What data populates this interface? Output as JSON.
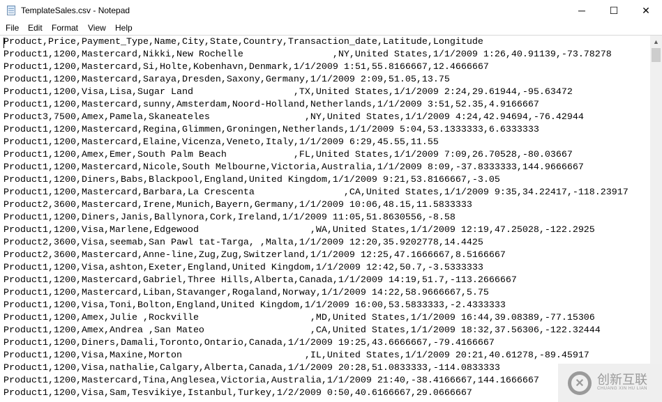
{
  "window": {
    "title": "TemplateSales.csv - Notepad",
    "minimize": "─",
    "maximize": "☐",
    "close": "✕"
  },
  "menu": [
    "File",
    "Edit",
    "Format",
    "View",
    "Help"
  ],
  "lines": [
    "Product,Price,Payment_Type,Name,City,State,Country,Transaction_date,Latitude,Longitude",
    "Product1,1200,Mastercard,Nikki,New Rochelle                ,NY,United States,1/1/2009 1:26,40.91139,-73.78278",
    "Product1,1200,Mastercard,Si,Holte,Kobenhavn,Denmark,1/1/2009 1:51,55.8166667,12.4666667",
    "Product1,1200,Mastercard,Saraya,Dresden,Saxony,Germany,1/1/2009 2:09,51.05,13.75",
    "Product1,1200,Visa,Lisa,Sugar Land                  ,TX,United States,1/1/2009 2:24,29.61944,-95.63472",
    "Product1,1200,Mastercard,sunny,Amsterdam,Noord-Holland,Netherlands,1/1/2009 3:51,52.35,4.9166667",
    "Product3,7500,Amex,Pamela,Skaneateles                 ,NY,United States,1/1/2009 4:24,42.94694,-76.42944",
    "Product1,1200,Mastercard,Regina,Glimmen,Groningen,Netherlands,1/1/2009 5:04,53.1333333,6.6333333",
    "Product1,1200,Mastercard,Elaine,Vicenza,Veneto,Italy,1/1/2009 6:29,45.55,11.55",
    "Product1,1200,Amex,Emer,South Palm Beach            ,FL,United States,1/1/2009 7:09,26.70528,-80.03667",
    "Product1,1200,Mastercard,Nicole,South Melbourne,Victoria,Australia,1/1/2009 8:09,-37.8333333,144.9666667",
    "Product1,1200,Diners,Babs,Blackpool,England,United Kingdom,1/1/2009 9:21,53.8166667,-3.05",
    "Product1,1200,Mastercard,Barbara,La Crescenta                ,CA,United States,1/1/2009 9:35,34.22417,-118.23917",
    "Product2,3600,Mastercard,Irene,Munich,Bayern,Germany,1/1/2009 10:06,48.15,11.5833333",
    "Product1,1200,Diners,Janis,Ballynora,Cork,Ireland,1/1/2009 11:05,51.8630556,-8.58",
    "Product1,1200,Visa,Marlene,Edgewood                    ,WA,United States,1/1/2009 12:19,47.25028,-122.2925",
    "Product2,3600,Visa,seemab,San Pawl tat-Targa, ,Malta,1/1/2009 12:20,35.9202778,14.4425",
    "Product2,3600,Mastercard,Anne-line,Zug,Zug,Switzerland,1/1/2009 12:25,47.1666667,8.5166667",
    "Product1,1200,Visa,ashton,Exeter,England,United Kingdom,1/1/2009 12:42,50.7,-3.5333333",
    "Product1,1200,Mastercard,Gabriel,Three Hills,Alberta,Canada,1/1/2009 14:19,51.7,-113.2666667",
    "Product1,1200,Mastercard,Liban,Stavanger,Rogaland,Norway,1/1/2009 14:22,58.9666667,5.75",
    "Product1,1200,Visa,Toni,Bolton,England,United Kingdom,1/1/2009 16:00,53.5833333,-2.4333333",
    "Product1,1200,Amex,Julie ,Rockville                    ,MD,United States,1/1/2009 16:44,39.08389,-77.15306",
    "Product1,1200,Amex,Andrea ,San Mateo                   ,CA,United States,1/1/2009 18:32,37.56306,-122.32444",
    "Product1,1200,Diners,Damali,Toronto,Ontario,Canada,1/1/2009 19:25,43.6666667,-79.4166667",
    "Product1,1200,Visa,Maxine,Morton                      ,IL,United States,1/1/2009 20:21,40.61278,-89.45917",
    "Product1,1200,Visa,nathalie,Calgary,Alberta,Canada,1/1/2009 20:28,51.0833333,-114.0833333",
    "Product1,1200,Mastercard,Tina,Anglesea,Victoria,Australia,1/1/2009 21:40,-38.4166667,144.1666667",
    "Product1,1200,Visa,Sam,Tesvikiye,Istanbul,Turkey,1/2/2009 0:50,40.6166667,29.0666667"
  ],
  "watermark": {
    "text": "创新互联",
    "subtext": "CHUANG XIN HU LIAN"
  }
}
